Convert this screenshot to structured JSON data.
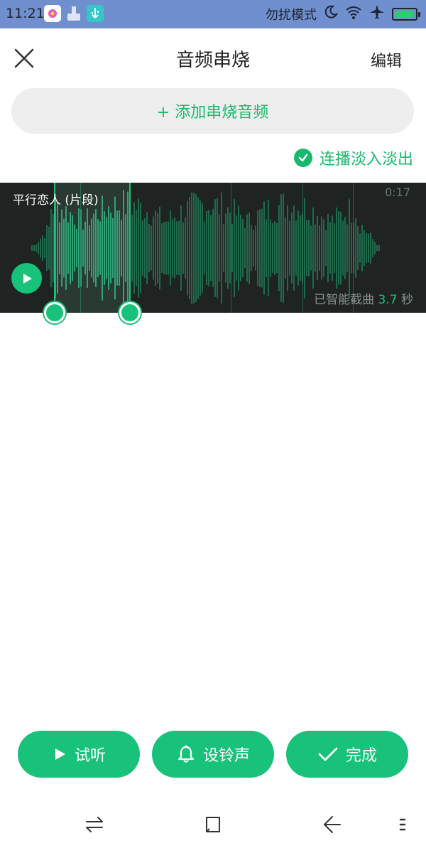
{
  "status_bar": {
    "time": "11:21",
    "mode_text": "勿扰模式",
    "battery_color": "#2ecc71"
  },
  "header": {
    "title": "音频串烧",
    "edit_label": "编辑",
    "close_icon": "close-icon"
  },
  "add_button": {
    "label": "+ 添加串烧音频"
  },
  "fade_toggle": {
    "label": "连播淡入淡出",
    "checked": true
  },
  "track": {
    "name": "平行恋人 (片段)",
    "duration": "0:17",
    "smart_cut_prefix": "已智能截曲",
    "smart_cut_value": "3.7",
    "smart_cut_unit": "秒"
  },
  "actions": {
    "preview_label": "试听",
    "ringtone_label": "设铃声",
    "done_label": "完成"
  },
  "colors": {
    "accent": "#19c27a",
    "status_bar": "#6f8fcf",
    "track_bg": "#1f2422"
  },
  "navbar": {
    "icons": [
      "switch-icon",
      "home-icon",
      "back-icon",
      "menu-icon"
    ]
  }
}
